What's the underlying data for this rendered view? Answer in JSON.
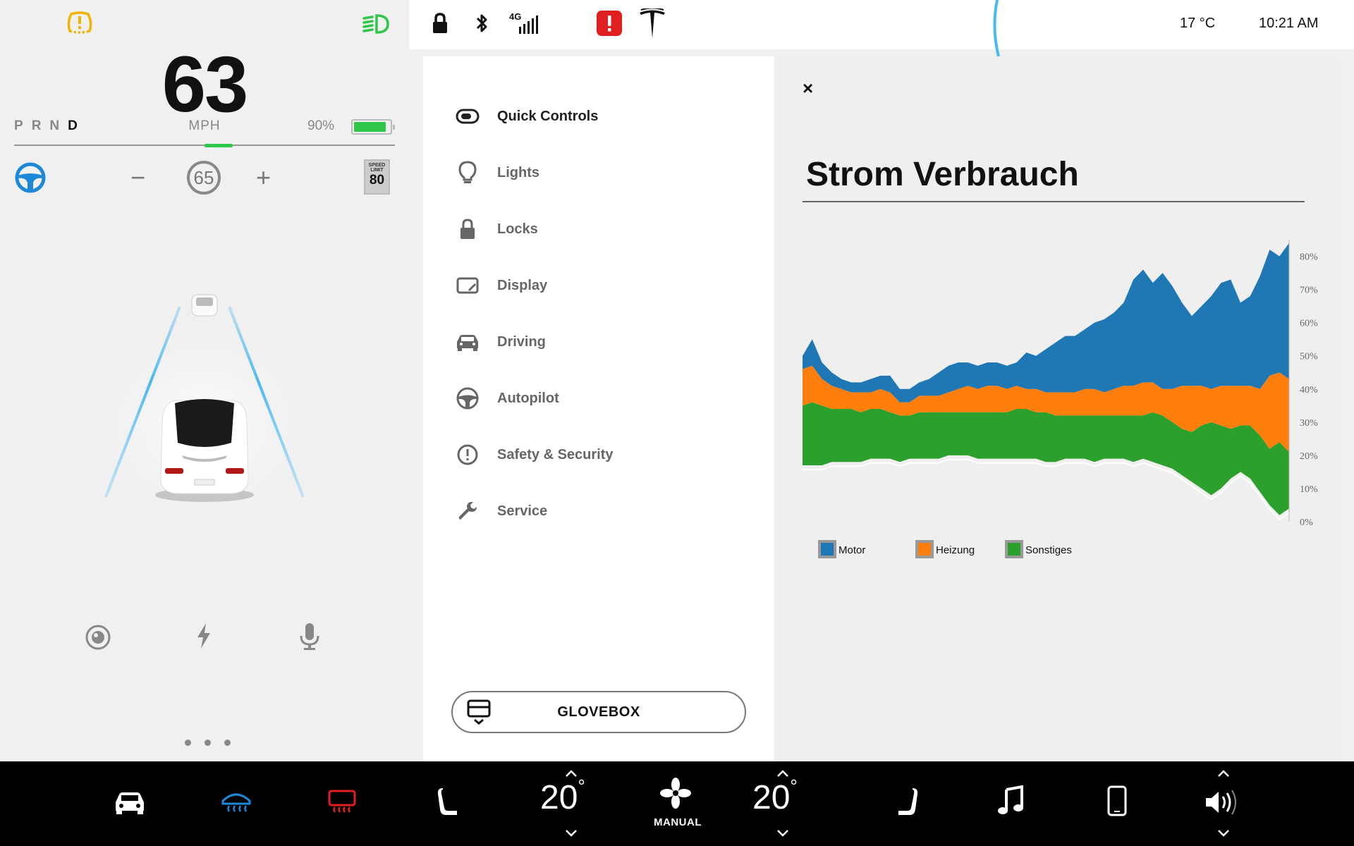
{
  "driver": {
    "speed": "63",
    "gears": [
      "P",
      "R",
      "N",
      "D"
    ],
    "active_gear": "D",
    "speed_unit": "MPH",
    "battery_percent": "90%",
    "battery_level": 0.9,
    "set_speed": "65",
    "set_minus": "−",
    "set_plus": "+",
    "speed_limit_label": "SPEED LIMIT",
    "speed_limit": "80"
  },
  "status": {
    "network": "4G",
    "outside_temp": "17 °C",
    "time": "10:21 AM"
  },
  "menu": {
    "items": [
      {
        "label": "Quick Controls",
        "icon": "toggle-icon",
        "active": true
      },
      {
        "label": "Lights",
        "icon": "bulb-icon",
        "active": false
      },
      {
        "label": "Locks",
        "icon": "lock-icon",
        "active": false
      },
      {
        "label": "Display",
        "icon": "display-icon",
        "active": false
      },
      {
        "label": "Driving",
        "icon": "car-icon",
        "active": false
      },
      {
        "label": "Autopilot",
        "icon": "steering-wheel-icon",
        "active": false
      },
      {
        "label": "Safety & Security",
        "icon": "alert-circle-icon",
        "active": false
      },
      {
        "label": "Service",
        "icon": "wrench-icon",
        "active": false
      }
    ],
    "glovebox_label": "GLOVEBOX"
  },
  "panel": {
    "title": "Strom Verbrauch",
    "close_label": "×"
  },
  "chart_data": {
    "type": "area",
    "title": "Strom Verbrauch",
    "y_ticks": [
      "0%",
      "10%",
      "20%",
      "30%",
      "40%",
      "50%",
      "60%",
      "70%",
      "80%"
    ],
    "ylim": [
      0,
      85
    ],
    "x": [
      0,
      1,
      2,
      3,
      4,
      5,
      6,
      7,
      8,
      9,
      10,
      11,
      12,
      13,
      14,
      15,
      16,
      17,
      18,
      19,
      20,
      21,
      22,
      23,
      24,
      25,
      26,
      27,
      28,
      29,
      30,
      31,
      32,
      33,
      34,
      35,
      36,
      37,
      38,
      39,
      40,
      41,
      42,
      43,
      44,
      45,
      46,
      47,
      48,
      49,
      50
    ],
    "series": [
      {
        "name": "Sonstiges",
        "color": "#2ca02c",
        "lower": [
          17,
          17,
          17,
          18,
          18,
          18,
          18,
          19,
          19,
          19,
          18,
          19,
          19,
          19,
          19,
          20,
          20,
          20,
          19,
          19,
          19,
          19,
          19,
          19,
          19,
          18,
          18,
          19,
          19,
          19,
          18,
          19,
          19,
          19,
          18,
          19,
          18,
          17,
          16,
          14,
          12,
          10,
          8,
          10,
          13,
          15,
          13,
          9,
          5,
          2,
          4
        ],
        "upper": [
          35,
          36,
          35,
          34,
          34,
          34,
          33,
          34,
          34,
          33,
          32,
          32,
          33,
          33,
          33,
          33,
          33,
          33,
          33,
          33,
          33,
          33,
          34,
          34,
          33,
          33,
          32,
          32,
          32,
          32,
          32,
          32,
          32,
          32,
          32,
          32,
          33,
          32,
          30,
          28,
          27,
          29,
          30,
          29,
          28,
          29,
          29,
          26,
          22,
          24,
          21
        ]
      },
      {
        "name": "Heizung",
        "color": "#ff7f0e",
        "lower": [
          35,
          36,
          35,
          34,
          34,
          34,
          33,
          34,
          34,
          33,
          32,
          32,
          33,
          33,
          33,
          33,
          33,
          33,
          33,
          33,
          33,
          33,
          34,
          34,
          33,
          33,
          32,
          32,
          32,
          32,
          32,
          32,
          32,
          32,
          32,
          32,
          33,
          32,
          30,
          28,
          27,
          29,
          30,
          29,
          28,
          29,
          29,
          26,
          22,
          24,
          21
        ],
        "upper": [
          46,
          47,
          43,
          41,
          40,
          39,
          39,
          39,
          40,
          39,
          36,
          36,
          38,
          38,
          38,
          39,
          40,
          41,
          40,
          41,
          41,
          40,
          41,
          40,
          40,
          39,
          39,
          39,
          39,
          40,
          40,
          39,
          40,
          41,
          41,
          42,
          42,
          40,
          40,
          41,
          41,
          41,
          40,
          41,
          41,
          41,
          41,
          40,
          44,
          45,
          43
        ]
      },
      {
        "name": "Motor",
        "color": "#1f77b4",
        "lower": [
          46,
          47,
          43,
          41,
          40,
          39,
          39,
          39,
          40,
          39,
          36,
          36,
          38,
          38,
          38,
          39,
          40,
          41,
          40,
          41,
          41,
          40,
          41,
          40,
          40,
          39,
          39,
          39,
          39,
          40,
          40,
          39,
          40,
          41,
          41,
          42,
          42,
          40,
          40,
          41,
          41,
          41,
          40,
          41,
          41,
          41,
          41,
          40,
          44,
          45,
          43
        ],
        "upper": [
          50,
          55,
          48,
          45,
          43,
          42,
          42,
          43,
          44,
          44,
          40,
          40,
          42,
          43,
          45,
          47,
          48,
          48,
          47,
          48,
          48,
          47,
          48,
          51,
          50,
          52,
          54,
          56,
          56,
          58,
          60,
          61,
          63,
          66,
          73,
          76,
          72,
          75,
          71,
          66,
          62,
          65,
          68,
          72,
          73,
          66,
          68,
          74,
          82,
          80,
          84
        ]
      }
    ],
    "legend": [
      {
        "name": "Motor",
        "color": "#1f77b4"
      },
      {
        "name": "Heizung",
        "color": "#ff7f0e"
      },
      {
        "name": "Sonstiges",
        "color": "#2ca02c"
      }
    ],
    "legend_position": "bottom-left"
  },
  "climate": {
    "driver_temp": "20",
    "passenger_temp": "20",
    "degree_symbol": "°",
    "fan_mode": "MANUAL"
  },
  "colors": {
    "accent_blue": "#1e88d8",
    "battery_green": "#2ec74a",
    "warning_amber": "#f0b400",
    "alert_red": "#e02020",
    "defrost_red": "#e02020"
  }
}
